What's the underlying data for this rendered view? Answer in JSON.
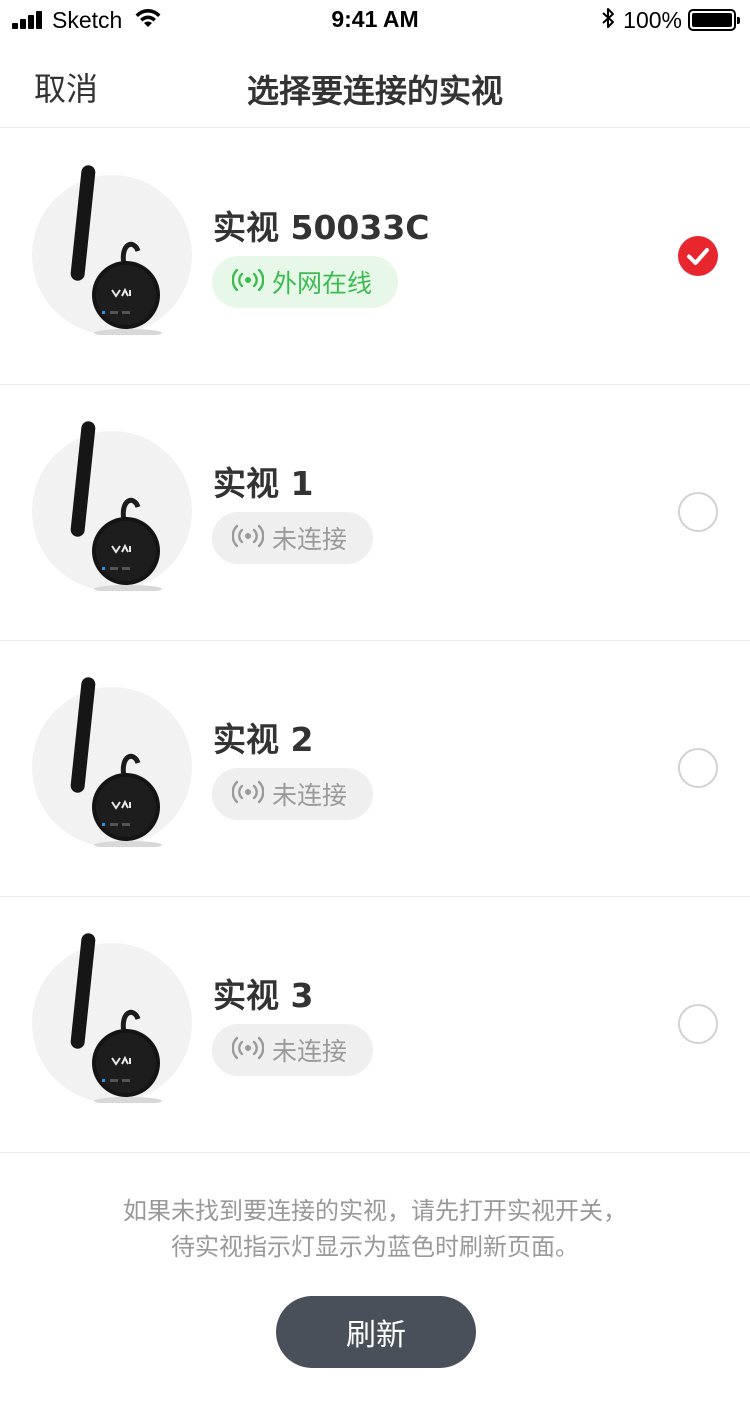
{
  "status_bar": {
    "carrier": "Sketch",
    "time": "9:41 AM",
    "battery": "100%",
    "battery_level": 1.0
  },
  "nav": {
    "cancel_label": "取消",
    "title": "选择要连接的实视"
  },
  "devices": [
    {
      "name": "实视 50033C",
      "status": "外网在线",
      "online": true,
      "selected": true
    },
    {
      "name": "实视 1",
      "status": "未连接",
      "online": false,
      "selected": false
    },
    {
      "name": "实视 2",
      "status": "未连接",
      "online": false,
      "selected": false
    },
    {
      "name": "实视 3",
      "status": "未连接",
      "online": false,
      "selected": false
    }
  ],
  "hint": {
    "line1": "如果未找到要连接的实视，请先打开实视开关，",
    "line2": "待实视指示灯显示为蓝色时刷新页面。"
  },
  "refresh_label": "刷新",
  "colors": {
    "accent_red": "#e8262e",
    "online_green": "#3dbb52",
    "online_bg": "#e7f8e9",
    "offline_gray": "#9a9a9a",
    "button_dark": "#4a5059"
  },
  "icons": {
    "signal": "cellular-signal-icon",
    "wifi": "wifi-icon",
    "bluetooth": "bluetooth-icon",
    "battery": "battery-icon",
    "status": "broadcast-signal-icon",
    "check": "checkmark-icon"
  }
}
